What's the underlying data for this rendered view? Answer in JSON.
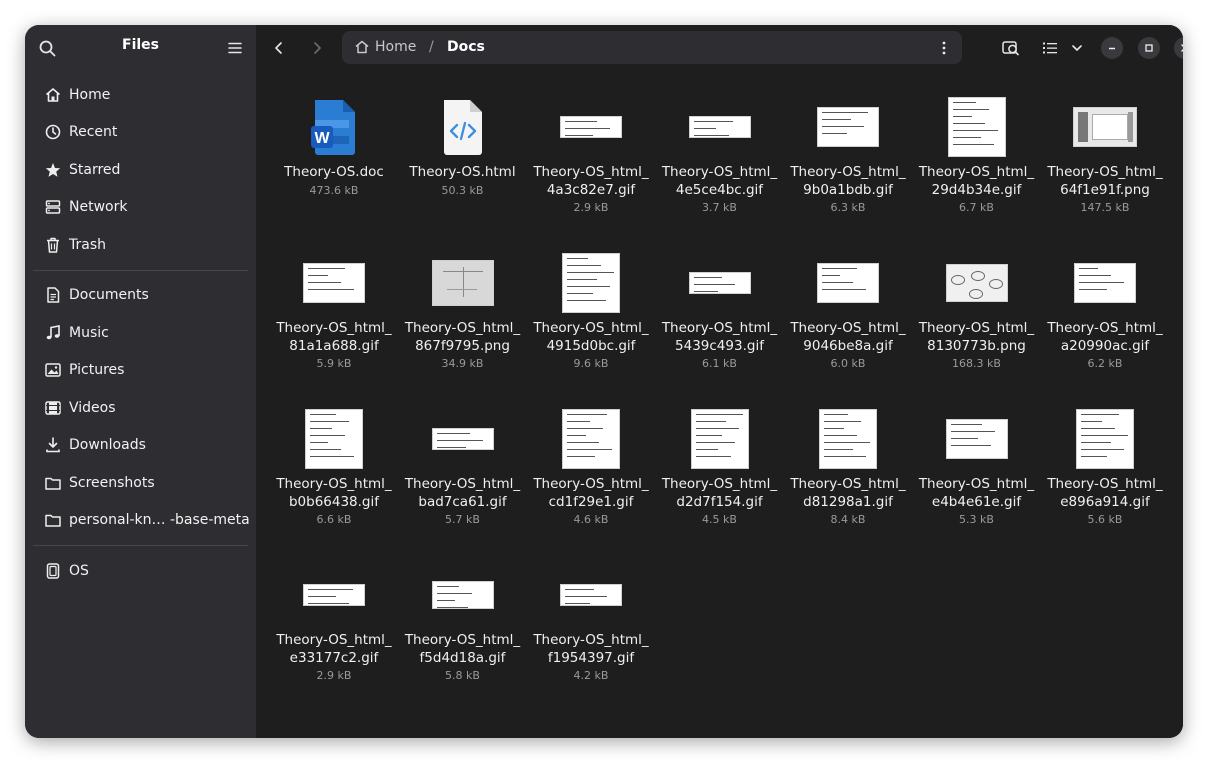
{
  "sidebar": {
    "title": "Files",
    "places": [
      {
        "label": "Home",
        "icon": "home-icon"
      },
      {
        "label": "Recent",
        "icon": "clock-icon"
      },
      {
        "label": "Starred",
        "icon": "star-icon"
      },
      {
        "label": "Network",
        "icon": "network-icon"
      },
      {
        "label": "Trash",
        "icon": "trash-icon"
      }
    ],
    "bookmarks": [
      {
        "label": "Documents",
        "icon": "document-icon"
      },
      {
        "label": "Music",
        "icon": "music-icon"
      },
      {
        "label": "Pictures",
        "icon": "picture-icon"
      },
      {
        "label": "Videos",
        "icon": "video-icon"
      },
      {
        "label": "Downloads",
        "icon": "download-icon"
      },
      {
        "label": "Screenshots",
        "icon": "folder-icon"
      },
      {
        "label": "personal-kn… -base-meta",
        "icon": "folder-icon"
      }
    ],
    "devices": [
      {
        "label": "OS",
        "icon": "drive-icon"
      }
    ]
  },
  "pathbar": {
    "home_label": "Home",
    "separator": "/",
    "current_label": "Docs"
  },
  "files": [
    {
      "name": "Theory-OS.doc",
      "size": "473.6 kB",
      "kind": "word"
    },
    {
      "name": "Theory-OS.html",
      "size": "50.3 kB",
      "kind": "html"
    },
    {
      "name": "Theory-OS_html_4a3c82e7.gif",
      "size": "2.9 kB",
      "kind": "img",
      "shape": "wide"
    },
    {
      "name": "Theory-OS_html_4e5ce4bc.gif",
      "size": "3.7 kB",
      "kind": "img",
      "shape": "wide"
    },
    {
      "name": "Theory-OS_html_9b0a1bdb.gif",
      "size": "6.3 kB",
      "kind": "img",
      "shape": "mid"
    },
    {
      "name": "Theory-OS_html_29d4b34e.gif",
      "size": "6.7 kB",
      "kind": "img",
      "shape": "tall"
    },
    {
      "name": "Theory-OS_html_64f1e91f.png",
      "size": "147.5 kB",
      "kind": "img",
      "shape": "screen"
    },
    {
      "name": "Theory-OS_html_81a1a688.gif",
      "size": "5.9 kB",
      "kind": "img",
      "shape": "mid"
    },
    {
      "name": "Theory-OS_html_867f9795.png",
      "size": "34.9 kB",
      "kind": "img",
      "shape": "grey"
    },
    {
      "name": "Theory-OS_html_4915d0bc.gif",
      "size": "9.6 kB",
      "kind": "img",
      "shape": "tall"
    },
    {
      "name": "Theory-OS_html_5439c493.gif",
      "size": "6.1 kB",
      "kind": "img",
      "shape": "wide"
    },
    {
      "name": "Theory-OS_html_9046be8a.gif",
      "size": "6.0 kB",
      "kind": "img",
      "shape": "mid"
    },
    {
      "name": "Theory-OS_html_8130773b.png",
      "size": "168.3 kB",
      "kind": "img",
      "shape": "diagram"
    },
    {
      "name": "Theory-OS_html_a20990ac.gif",
      "size": "6.2 kB",
      "kind": "img",
      "shape": "mid"
    },
    {
      "name": "Theory-OS_html_b0b66438.gif",
      "size": "6.6 kB",
      "kind": "img",
      "shape": "tall"
    },
    {
      "name": "Theory-OS_html_bad7ca61.gif",
      "size": "5.7 kB",
      "kind": "img",
      "shape": "wide"
    },
    {
      "name": "Theory-OS_html_cd1f29e1.gif",
      "size": "4.6 kB",
      "kind": "img",
      "shape": "tall"
    },
    {
      "name": "Theory-OS_html_d2d7f154.gif",
      "size": "4.5 kB",
      "kind": "img",
      "shape": "tall"
    },
    {
      "name": "Theory-OS_html_d81298a1.gif",
      "size": "8.4 kB",
      "kind": "img",
      "shape": "tall"
    },
    {
      "name": "Theory-OS_html_e4b4e61e.gif",
      "size": "5.3 kB",
      "kind": "img",
      "shape": "mid"
    },
    {
      "name": "Theory-OS_html_e896a914.gif",
      "size": "5.6 kB",
      "kind": "img",
      "shape": "tall"
    },
    {
      "name": "Theory-OS_html_e33177c2.gif",
      "size": "2.9 kB",
      "kind": "img",
      "shape": "wide"
    },
    {
      "name": "Theory-OS_html_f5d4d18a.gif",
      "size": "5.8 kB",
      "kind": "img",
      "shape": "midwide"
    },
    {
      "name": "Theory-OS_html_f1954397.gif",
      "size": "4.2 kB",
      "kind": "img",
      "shape": "wide"
    }
  ],
  "colors": {
    "window_bg": "#1e1e1e",
    "sidebar_bg": "#2e2e32",
    "word_blue": "#2b7cd3",
    "html_blue": "#3b8fe0"
  }
}
